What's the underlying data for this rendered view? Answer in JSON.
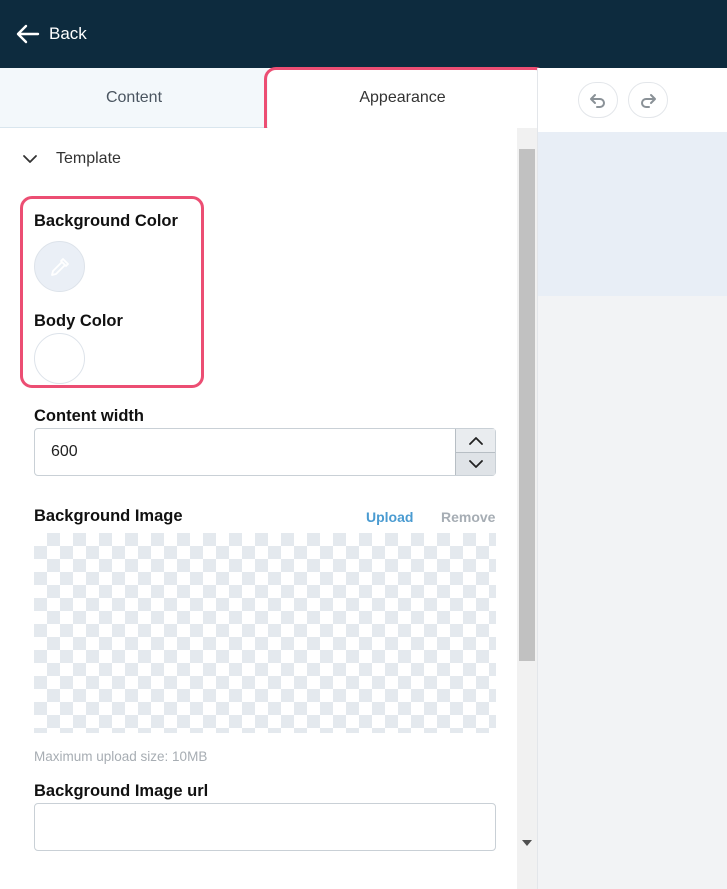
{
  "topbar": {
    "back_label": "Back"
  },
  "tabs": [
    {
      "label": "Content",
      "active": false
    },
    {
      "label": "Appearance",
      "active": true
    }
  ],
  "panel": {
    "section_title": "Template",
    "background_color_label": "Background Color",
    "body_color_label": "Body Color",
    "content_width_label": "Content width",
    "content_width_value": "600",
    "background_image_label": "Background Image",
    "upload_label": "Upload",
    "remove_label": "Remove",
    "upload_hint": "Maximum upload size: 10MB",
    "background_image_url_label": "Background Image url",
    "background_image_url_value": ""
  },
  "colors": {
    "topbar": "#0d2b3e",
    "highlight": "#ec4e73",
    "link": "#4a9bd1",
    "background_color_swatch": "#eaeff6",
    "body_color_swatch": "#ffffff"
  },
  "icons": {
    "back": "arrow-left-icon",
    "section_toggle": "chevron-down-icon",
    "background_color": "eyedropper-icon",
    "undo": "undo-icon",
    "redo": "redo-icon",
    "increment": "chevron-up-icon",
    "decrement": "chevron-down-icon"
  }
}
